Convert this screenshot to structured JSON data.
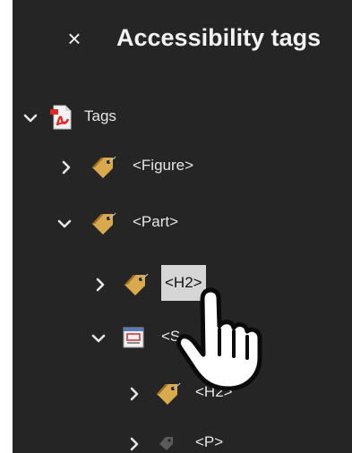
{
  "panel": {
    "close_label": "×",
    "title": "Accessibility tags"
  },
  "tree": {
    "root": {
      "label": "Tags",
      "icon": "pdf-document-icon",
      "expanded": true
    },
    "figure": {
      "label": "<Figure>",
      "icon": "tag-icon",
      "expanded": false
    },
    "part": {
      "label": "<Part>",
      "icon": "tag-icon",
      "expanded": true
    },
    "h2": {
      "label": "<H2>",
      "icon": "tag-icon",
      "expanded": false,
      "selected": true
    },
    "sect": {
      "label": "<S",
      "icon": "container-element-icon",
      "expanded": true
    },
    "h2_child": {
      "label": "<H2>",
      "icon": "tag-icon",
      "expanded": false
    },
    "p": {
      "label": "<P>",
      "icon": "tag-icon",
      "expanded": false
    }
  },
  "colors": {
    "panel_bg": "#252525",
    "tag_icon": "#d9a94e",
    "pdf_icon": "#e32626",
    "selection": "#d6d6d6"
  }
}
